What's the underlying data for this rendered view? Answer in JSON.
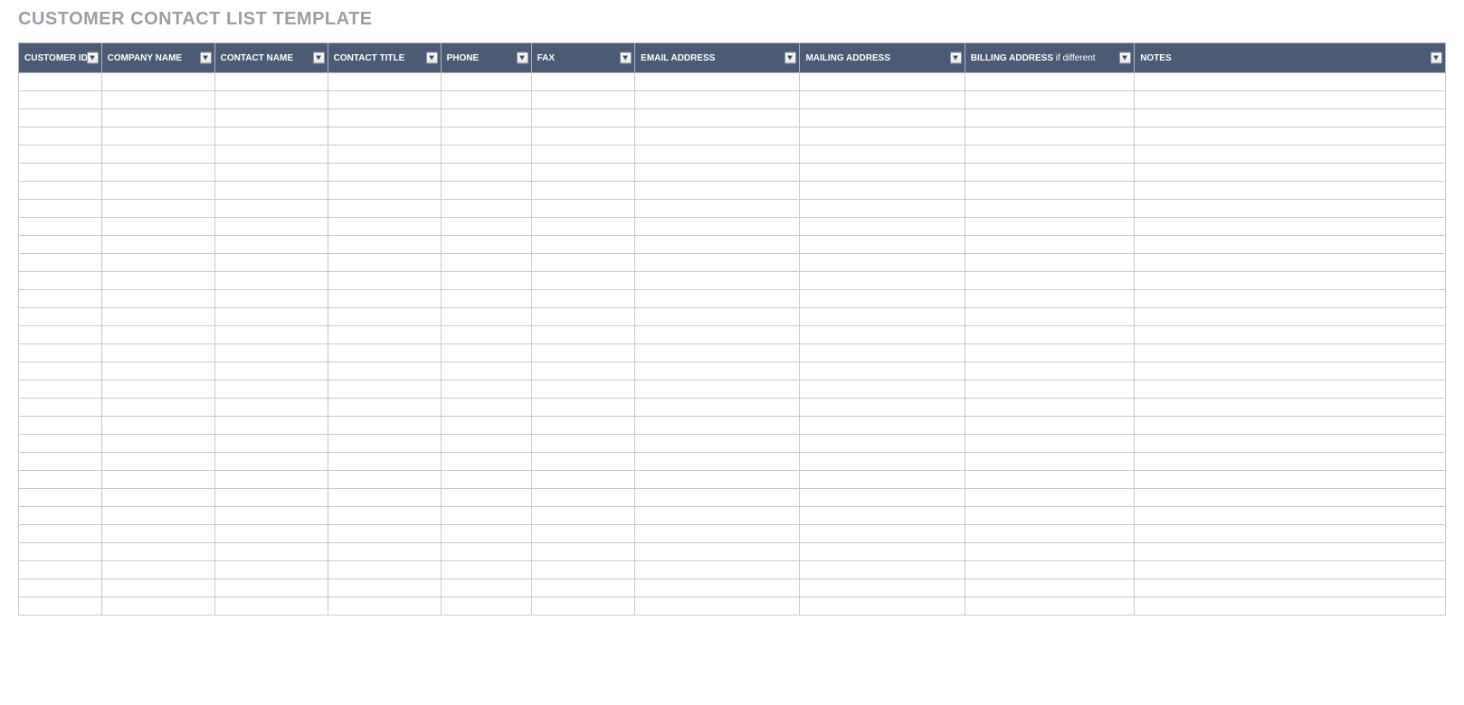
{
  "title": "CUSTOMER CONTACT LIST TEMPLATE",
  "columns": [
    {
      "label": "CUSTOMER ID",
      "suffix": ""
    },
    {
      "label": "COMPANY NAME",
      "suffix": ""
    },
    {
      "label": "CONTACT NAME",
      "suffix": ""
    },
    {
      "label": "CONTACT TITLE",
      "suffix": ""
    },
    {
      "label": "PHONE",
      "suffix": ""
    },
    {
      "label": "FAX",
      "suffix": ""
    },
    {
      "label": "EMAIL ADDRESS",
      "suffix": ""
    },
    {
      "label": "MAILING ADDRESS",
      "suffix": ""
    },
    {
      "label": "BILLING ADDRESS",
      "suffix": " if different"
    },
    {
      "label": "NOTES",
      "suffix": ""
    }
  ],
  "row_count": 30,
  "shaded_columns_light": [
    0
  ],
  "shaded_columns_blue": [
    1,
    2,
    3
  ],
  "colors": {
    "header_bg": "#4c5a74",
    "title_fg": "#9aa0a6",
    "shade_light": "#f2f2f2",
    "shade_blue": "#e2e7ef"
  }
}
